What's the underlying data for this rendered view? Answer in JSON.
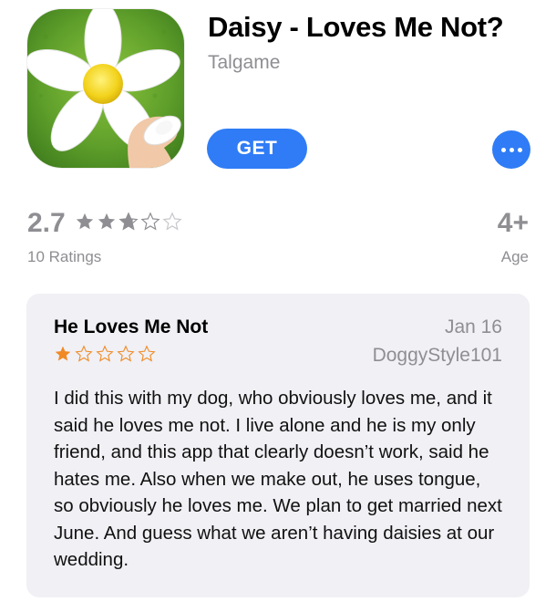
{
  "app": {
    "title": "Daisy - Loves Me Not?",
    "developer": "Talgame",
    "get_label": "GET",
    "icon": "daisy-flower-app-icon",
    "accent_color": "#2f7cf6"
  },
  "ratings": {
    "value": "2.7",
    "stars_out_of_5": 2.7,
    "count_label": "10 Ratings",
    "star_color": "#8e8e93"
  },
  "age": {
    "value": "4+",
    "label": "Age"
  },
  "review": {
    "title": "He Loves Me Not",
    "date": "Jan 16",
    "author": "DoggyStyle101",
    "stars": 1,
    "star_color": "#f08a24",
    "body": "I did this with my dog, who obviously loves me, and it said he loves me not. I live  alone and he is my only friend, and this app that clearly doesn’t work, said he hates me. Also when we make out, he uses tongue, so obviously he loves me. We plan to get married next June. And guess what we aren’t having daisies at our wedding."
  }
}
